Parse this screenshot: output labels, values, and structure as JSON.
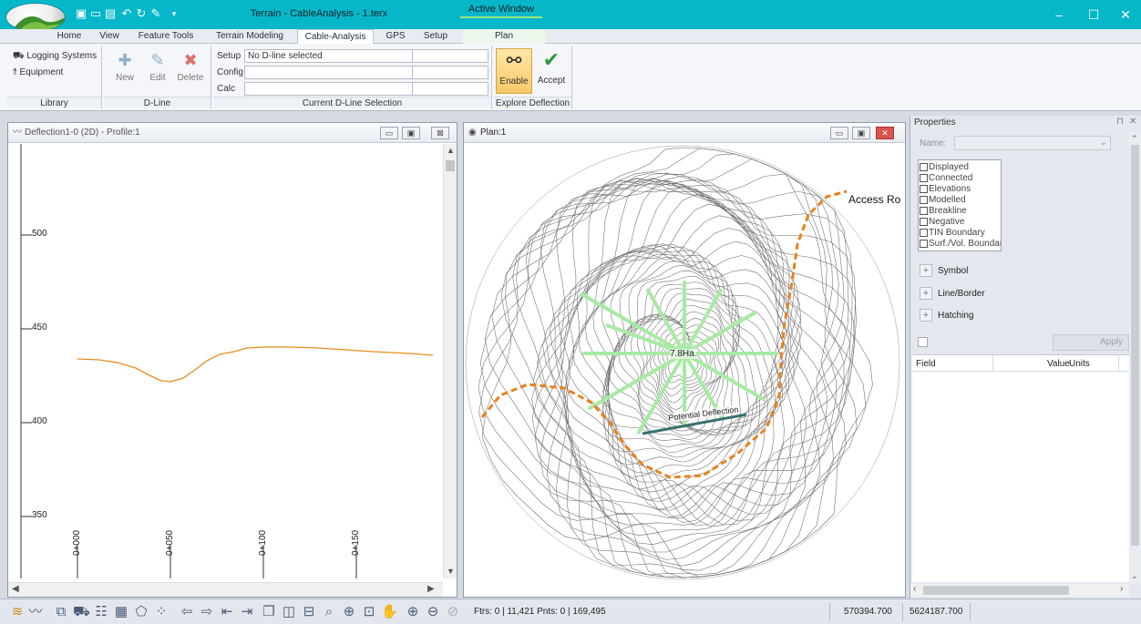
{
  "window": {
    "title": "Terrain - CableAnalysis - 1.terx",
    "active_window_tab": "Active Window",
    "plan_tab": "Plan"
  },
  "menu_tabs": [
    "Home",
    "View",
    "Feature Tools",
    "Terrain Modeling",
    "Cable-Analysis",
    "GPS",
    "Setup"
  ],
  "active_tab": "Cable-Analysis",
  "ribbon": {
    "library": {
      "label": "Library",
      "items": [
        "Logging Systems",
        "Equipment"
      ]
    },
    "dline": {
      "label": "D-Line",
      "new": "New",
      "edit": "Edit",
      "delete": "Delete"
    },
    "current": {
      "label": "Current D-Line Selection",
      "setup_label": "Setup",
      "setup_value": "No D-line selected",
      "config_label": "Config",
      "calc_label": "Calc",
      "dash": "-"
    },
    "explore": {
      "label": "Explore Deflection",
      "enable": "Enable",
      "accept": "Accept"
    }
  },
  "profile_panel": {
    "title": "Deflection1-0 (2D) - Profile:1",
    "y_ticks": [
      "500",
      "450",
      "400",
      "350"
    ],
    "x_ticks": [
      "0+000",
      "0+050",
      "0+100",
      "0+150"
    ]
  },
  "plan_panel": {
    "title": "Plan:1",
    "labels": {
      "area": "7.8Ha.",
      "deflection": "Potential Deflection",
      "road": "Access Ro"
    }
  },
  "properties": {
    "title": "Properties",
    "name_label": "Name:",
    "checks": [
      "Displayed",
      "Connected",
      "Elevations",
      "Modelled",
      "Breakline",
      "Negative",
      "TIN Boundary",
      "Surf./Vol. Boundary"
    ],
    "sections": [
      "Symbol",
      "Line/Border",
      "Hatching"
    ],
    "apply": "Apply",
    "table_headers": {
      "field": "Field",
      "value": "Value",
      "units": "Units"
    }
  },
  "status": {
    "counts": "Ftrs: 0 | 11,421  Pnts: 0 | 169,495",
    "easting": "570394.700",
    "northing": "5624187.700"
  },
  "colors": {
    "titlebar": "#06b7c9",
    "profile_line": "#e88a1f",
    "road": "#e8821e",
    "deflection_rays": "#a8eaa4",
    "deflection_line": "#3a7070"
  }
}
